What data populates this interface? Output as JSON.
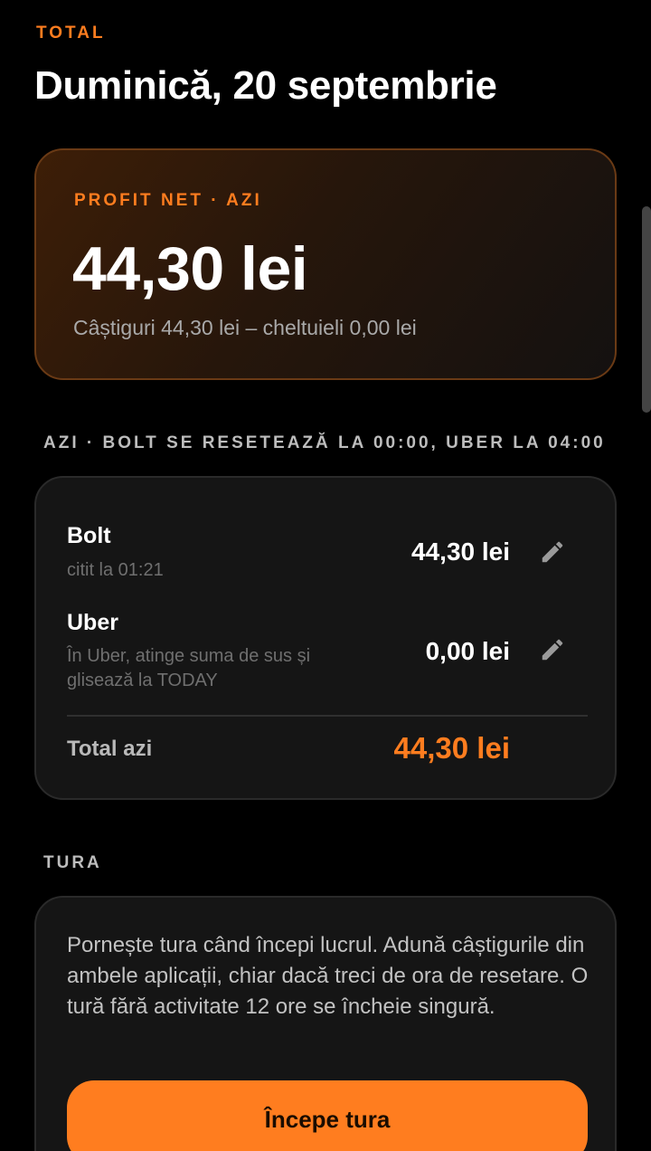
{
  "header": {
    "overline": "TOTAL",
    "date_title": "Duminică, 20 septembrie"
  },
  "profit_card": {
    "label": "PROFIT NET · AZI",
    "amount": "44,30 lei",
    "breakdown": "Câștiguri 44,30 lei – cheltuieli 0,00 lei"
  },
  "today_section": {
    "label": "AZI · BOLT SE RESETEAZĂ LA 00:00, UBER LA 04:00",
    "platforms": [
      {
        "name": "Bolt",
        "note": "citit la 01:21",
        "amount": "44,30 lei",
        "icon": "pencil-edit-icon"
      },
      {
        "name": "Uber",
        "note": "În Uber, atinge suma de sus și glisează la TODAY",
        "amount": "0,00 lei",
        "icon": "pencil-edit-icon"
      }
    ],
    "total_label": "Total azi",
    "total_amount": "44,30 lei"
  },
  "shift_section": {
    "label": "TURA",
    "description": "Pornește tura când începi lucrul. Adună câștigurile din ambele aplicații, chiar dacă treci de ora de resetare. O tură fără activitate 12 ore se încheie singură.",
    "button_label": "Începe tura"
  },
  "colors": {
    "accent": "#ff7d1f",
    "background": "#000000",
    "card": "#151515"
  }
}
